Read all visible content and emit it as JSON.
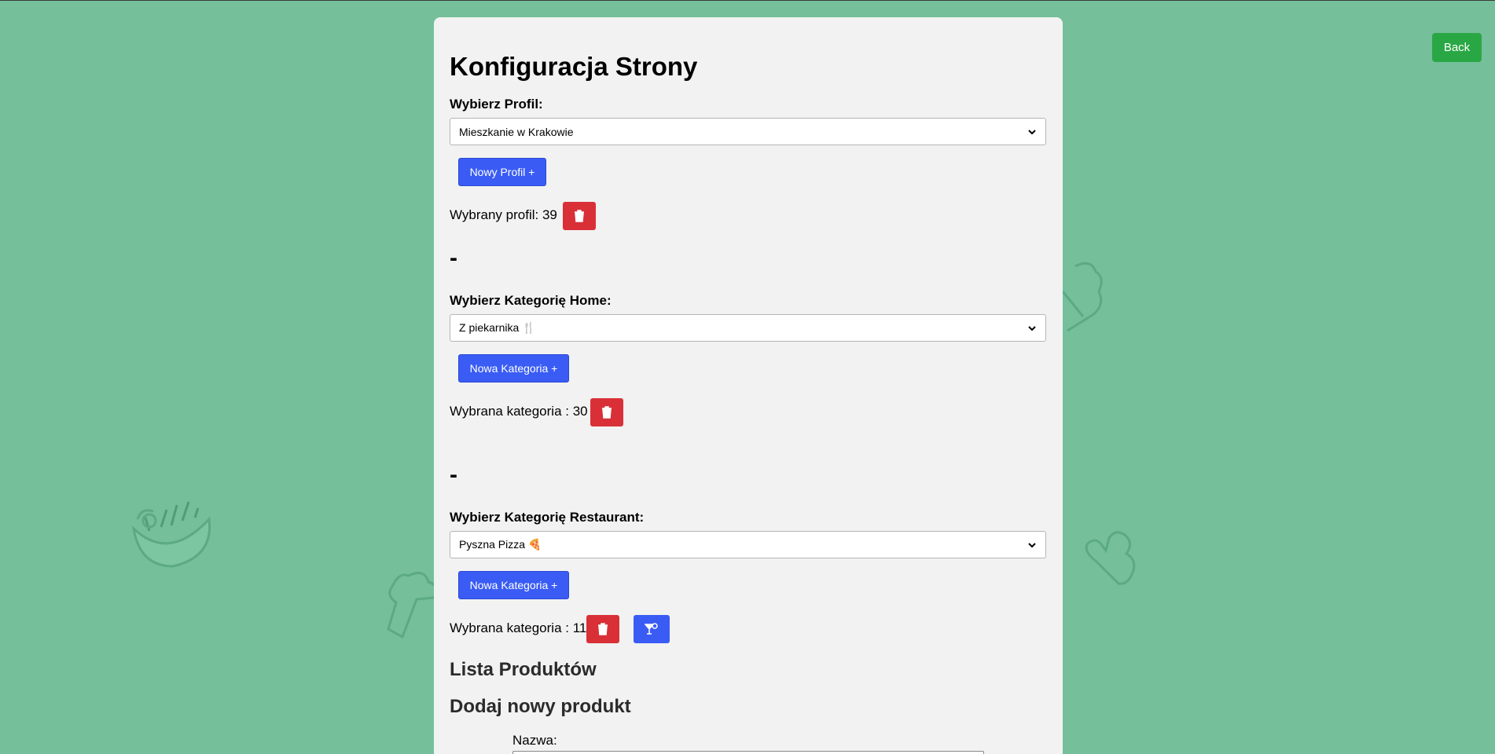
{
  "back_button": {
    "label": "Back"
  },
  "page": {
    "title": "Konfiguracja Strony"
  },
  "profile": {
    "label": "Wybierz Profil:",
    "selected": "Mieszkanie w Krakowie",
    "new_button": "Nowy Profil +",
    "selected_text": "Wybrany profil: 39"
  },
  "separator": "-",
  "home_category": {
    "label": "Wybierz Kategorię Home:",
    "selected": "Z piekarnika 🍴",
    "new_button": "Nowa Kategoria +",
    "selected_text": "Wybrana kategoria : 30"
  },
  "restaurant_category": {
    "label": "Wybierz Kategorię Restaurant:",
    "selected": "Pyszna Pizza 🍕",
    "new_button": "Nowa Kategoria +",
    "selected_text": "Wybrana kategoria : 11"
  },
  "products": {
    "list_title": "Lista Produktów",
    "add_title": "Dodaj nowy produkt",
    "name_label": "Nazwa:"
  },
  "icons": {
    "delete": "trash-icon",
    "cocktail": "cocktail-icon",
    "dropdown": "chevron-down-icon"
  },
  "colors": {
    "background": "#75bf9b",
    "panel": "#f2f2f2",
    "primary": "#3a5cf5",
    "danger": "#d93038",
    "success": "#2aa745"
  }
}
